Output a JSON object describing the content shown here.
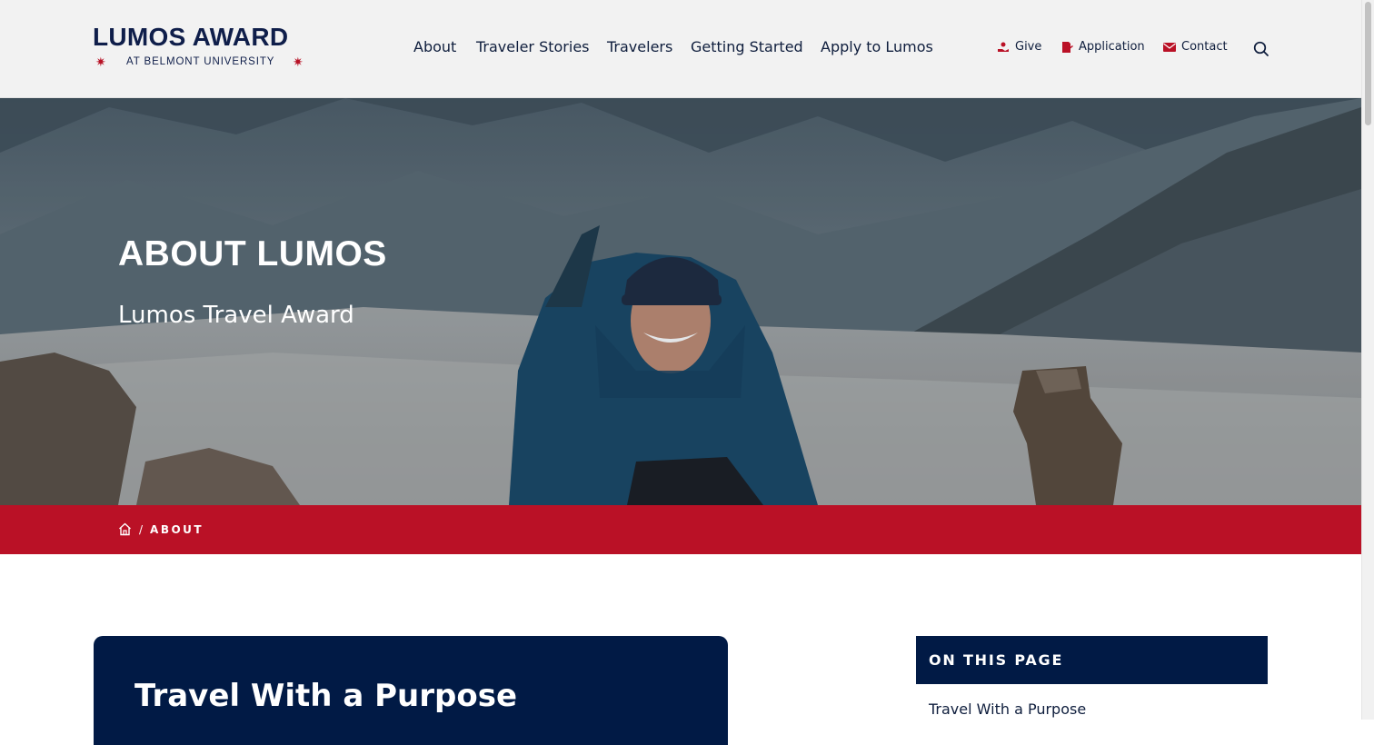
{
  "brand": {
    "title": "LUMOS AWARD",
    "subtitle": "AT BELMONT UNIVERSITY"
  },
  "main_nav": [
    "About",
    "Traveler Stories",
    "Travelers",
    "Getting Started",
    "Apply to Lumos"
  ],
  "utility_nav": [
    {
      "label": "Give",
      "icon": "give-icon"
    },
    {
      "label": "Application",
      "icon": "application-icon"
    },
    {
      "label": "Contact",
      "icon": "mail-icon"
    }
  ],
  "hero": {
    "title": "ABOUT LUMOS",
    "subtitle": "Lumos Travel Award"
  },
  "breadcrumb": {
    "separator": "/",
    "current": "ABOUT"
  },
  "content": {
    "section_title": "Travel With a Purpose"
  },
  "on_this_page": {
    "heading": "ON THIS PAGE",
    "links": [
      "Travel With a Purpose"
    ]
  },
  "colors": {
    "navy": "#011a45",
    "red": "#ba1126",
    "header_bg": "#f2f2f2"
  }
}
